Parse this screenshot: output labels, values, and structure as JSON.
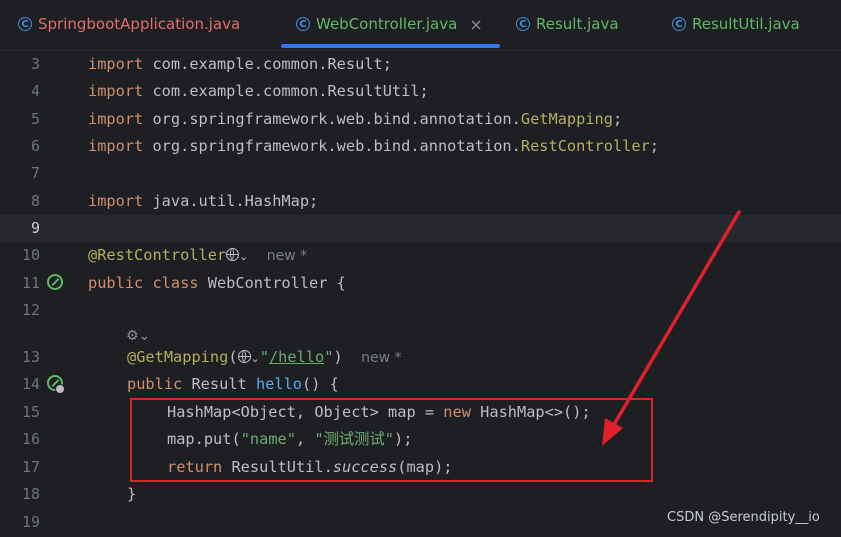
{
  "tabs": [
    {
      "label": "SpringbootApplication.java",
      "color": "#e06c6c",
      "active": false
    },
    {
      "label": "WebController.java",
      "color": "#5fb865",
      "active": true,
      "close": "×"
    },
    {
      "label": "Result.java",
      "color": "#5fb865",
      "active": false
    },
    {
      "label": "ResultUtil.java",
      "color": "#5fb865",
      "active": false
    }
  ],
  "tab_icon_letter": "C",
  "lines": {
    "n3": "3",
    "n4": "4",
    "n5": "5",
    "n6": "6",
    "n7": "7",
    "n8": "8",
    "n9": "9",
    "n10": "10",
    "n11": "11",
    "n12": "12",
    "n13": "13",
    "n14": "14",
    "n15": "15",
    "n16": "16",
    "n17": "17",
    "n18": "18",
    "n19": "19"
  },
  "code": {
    "import_kw": "import",
    "l3_path": " com.example.common.Result;",
    "l4_path": " com.example.common.ResultUtil;",
    "l5_path": " org.springframework.web.bind.annotation.",
    "l5_cls": "GetMapping",
    "semi": ";",
    "l6_path": " org.springframework.web.bind.annotation.",
    "l6_cls": "RestController",
    "l8_path": " java.util.HashMap;",
    "l10_ann": "@RestController",
    "new_hint": "new *",
    "l11_public": "public",
    "l11_class": " class",
    "l11_rest": " WebController {",
    "l13_ann": "@GetMapping",
    "l13_open": "(",
    "l13_q1": "\"",
    "l13_path": "/hello",
    "l13_q2": "\"",
    "l13_close": ")",
    "l14_public": "public",
    "l14_type": " Result ",
    "l14_fn": "hello",
    "l14_rest": "() {",
    "l15_a": "HashMap<Object, Object> map = ",
    "l15_new": "new",
    "l15_b": " HashMap<>();",
    "l16_a": "map.put(",
    "l16_s1": "\"name\"",
    "l16_comma": ", ",
    "l16_s2": "\"测试测试\"",
    "l16_b": ");",
    "l17_return": "return",
    "l17_a": " ResultUtil.",
    "l17_success": "success",
    "l17_b": "(map);",
    "l18": "}"
  },
  "watermark": "CSDN @Serendipity__io",
  "colors": {
    "background": "#1e1f22",
    "keyword": "#cf8e6d",
    "annotation": "#b3ae60",
    "string": "#6aab73",
    "function": "#56a8f5",
    "highlight_box": "#e0202a",
    "arrow": "#e0202a",
    "tab_underline": "#3574f0"
  }
}
